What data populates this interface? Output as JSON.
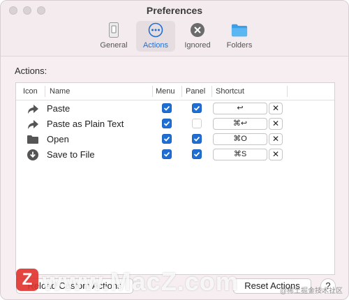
{
  "window": {
    "title": "Preferences"
  },
  "tabs": [
    {
      "label": "General",
      "icon": "switch-icon",
      "active": false
    },
    {
      "label": "Actions",
      "icon": "ellipsis-circle-icon",
      "active": true
    },
    {
      "label": "Ignored",
      "icon": "x-circle-icon",
      "active": false
    },
    {
      "label": "Folders",
      "icon": "folder-icon",
      "active": false
    }
  ],
  "actions": {
    "section_label": "Actions:",
    "columns": [
      "Icon",
      "Name",
      "Menu",
      "Panel",
      "Shortcut"
    ],
    "rows": [
      {
        "icon": "share-arrow-icon",
        "name": "Paste",
        "menu": true,
        "panel": true,
        "shortcut": "↩",
        "clear": "✕"
      },
      {
        "icon": "share-arrow-icon",
        "name": "Paste as Plain Text",
        "menu": true,
        "panel": false,
        "shortcut": "⌘↩",
        "clear": "✕"
      },
      {
        "icon": "folder-icon",
        "name": "Open",
        "menu": true,
        "panel": true,
        "shortcut": "⌘O",
        "clear": "✕"
      },
      {
        "icon": "download-circle-icon",
        "name": "Save to File",
        "menu": true,
        "panel": true,
        "shortcut": "⌘S",
        "clear": "✕"
      }
    ]
  },
  "buttons": {
    "reload": "Reload Custom Actions",
    "reset": "Reset Actions",
    "help": "?"
  },
  "watermark": {
    "logo": "Z",
    "text": "www.MacZ.com",
    "corner": "@稀土掘金技术社区"
  },
  "colors": {
    "accent": "#1f6ed4",
    "window_bg": "#f6eef1"
  }
}
